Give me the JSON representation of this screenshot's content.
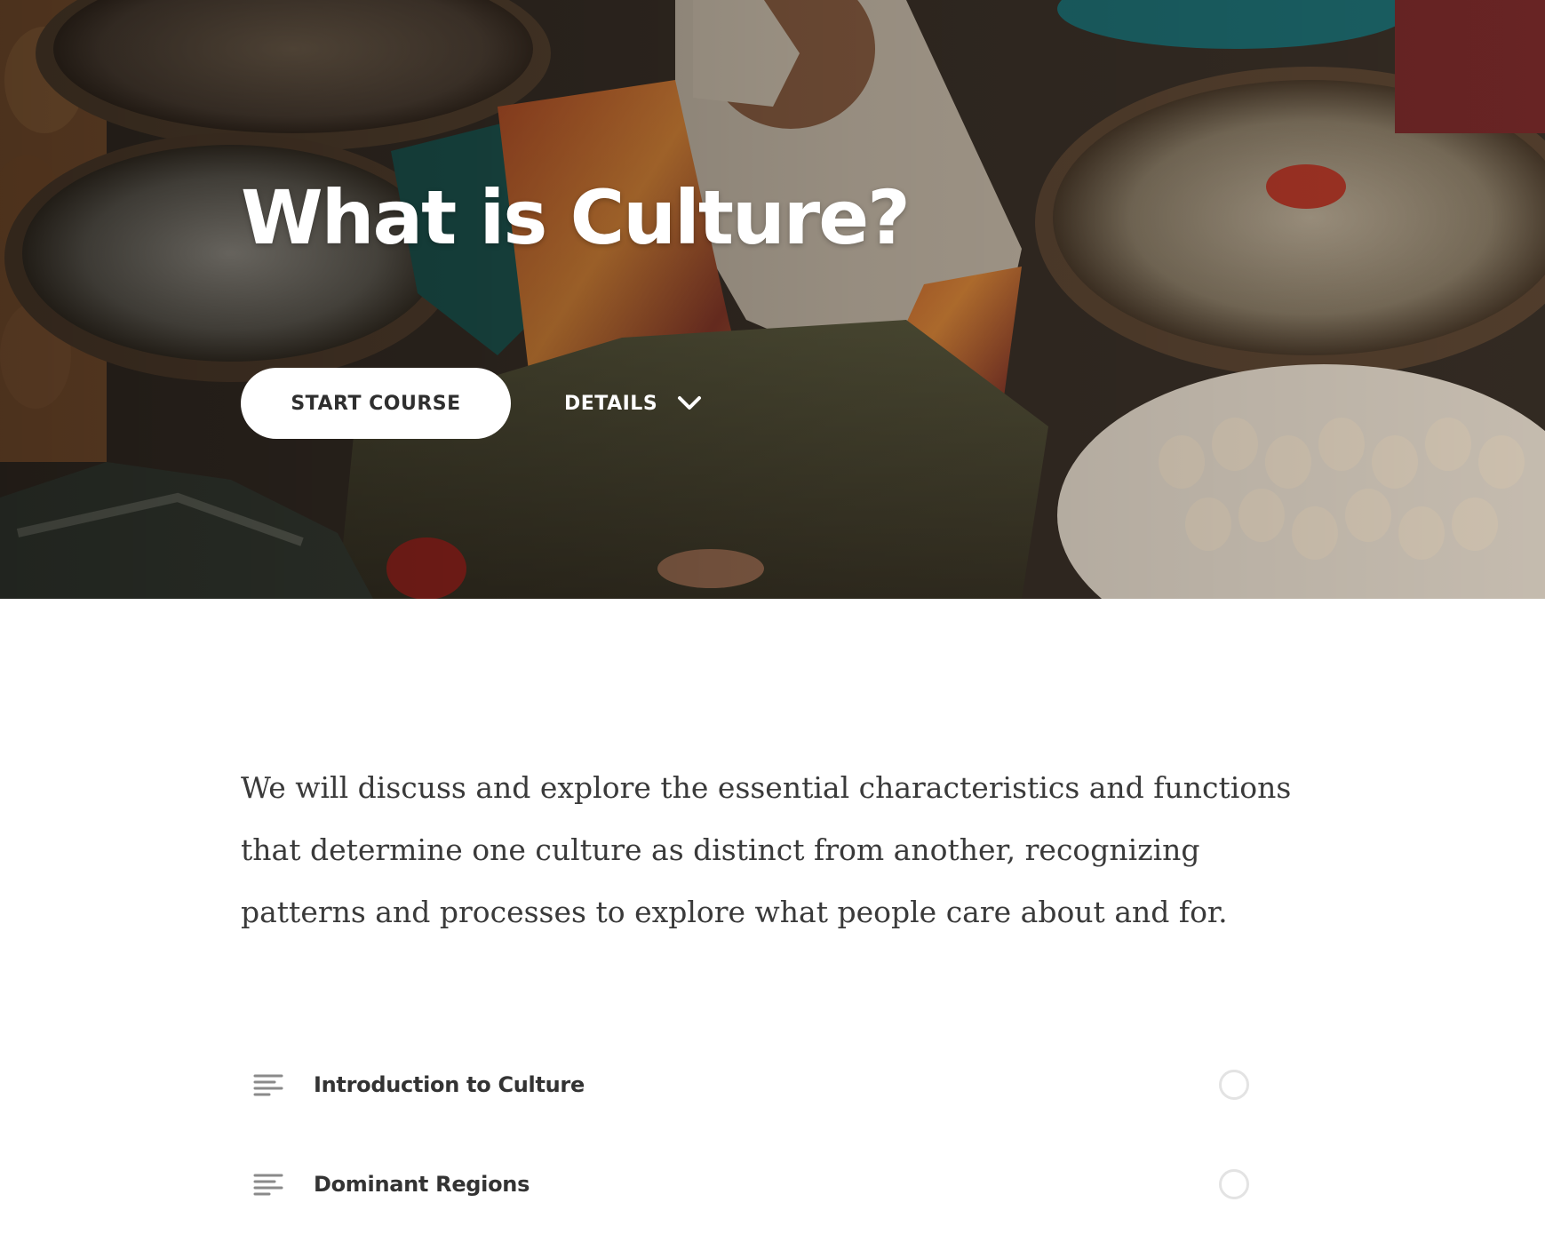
{
  "hero": {
    "title": "What is Culture?",
    "start_label": "START COURSE",
    "details_label": "DETAILS",
    "details_icon": "chevron-down-icon",
    "background": "market-stall-photo"
  },
  "description": "We will discuss and explore the essential characteristics and functions that determine one culture as distinct from another, recognizing patterns and processes to explore what people care about and for.",
  "lessons": [
    {
      "title": "Introduction to Culture",
      "icon": "text-lines-icon",
      "completed": false
    },
    {
      "title": "Dominant Regions",
      "icon": "text-lines-icon",
      "completed": false
    }
  ],
  "colors": {
    "text_dark": "#333333",
    "body_text": "#3a3a3a",
    "status_ring": "#e3e3e3",
    "icon_gray": "#8a8a8a"
  }
}
